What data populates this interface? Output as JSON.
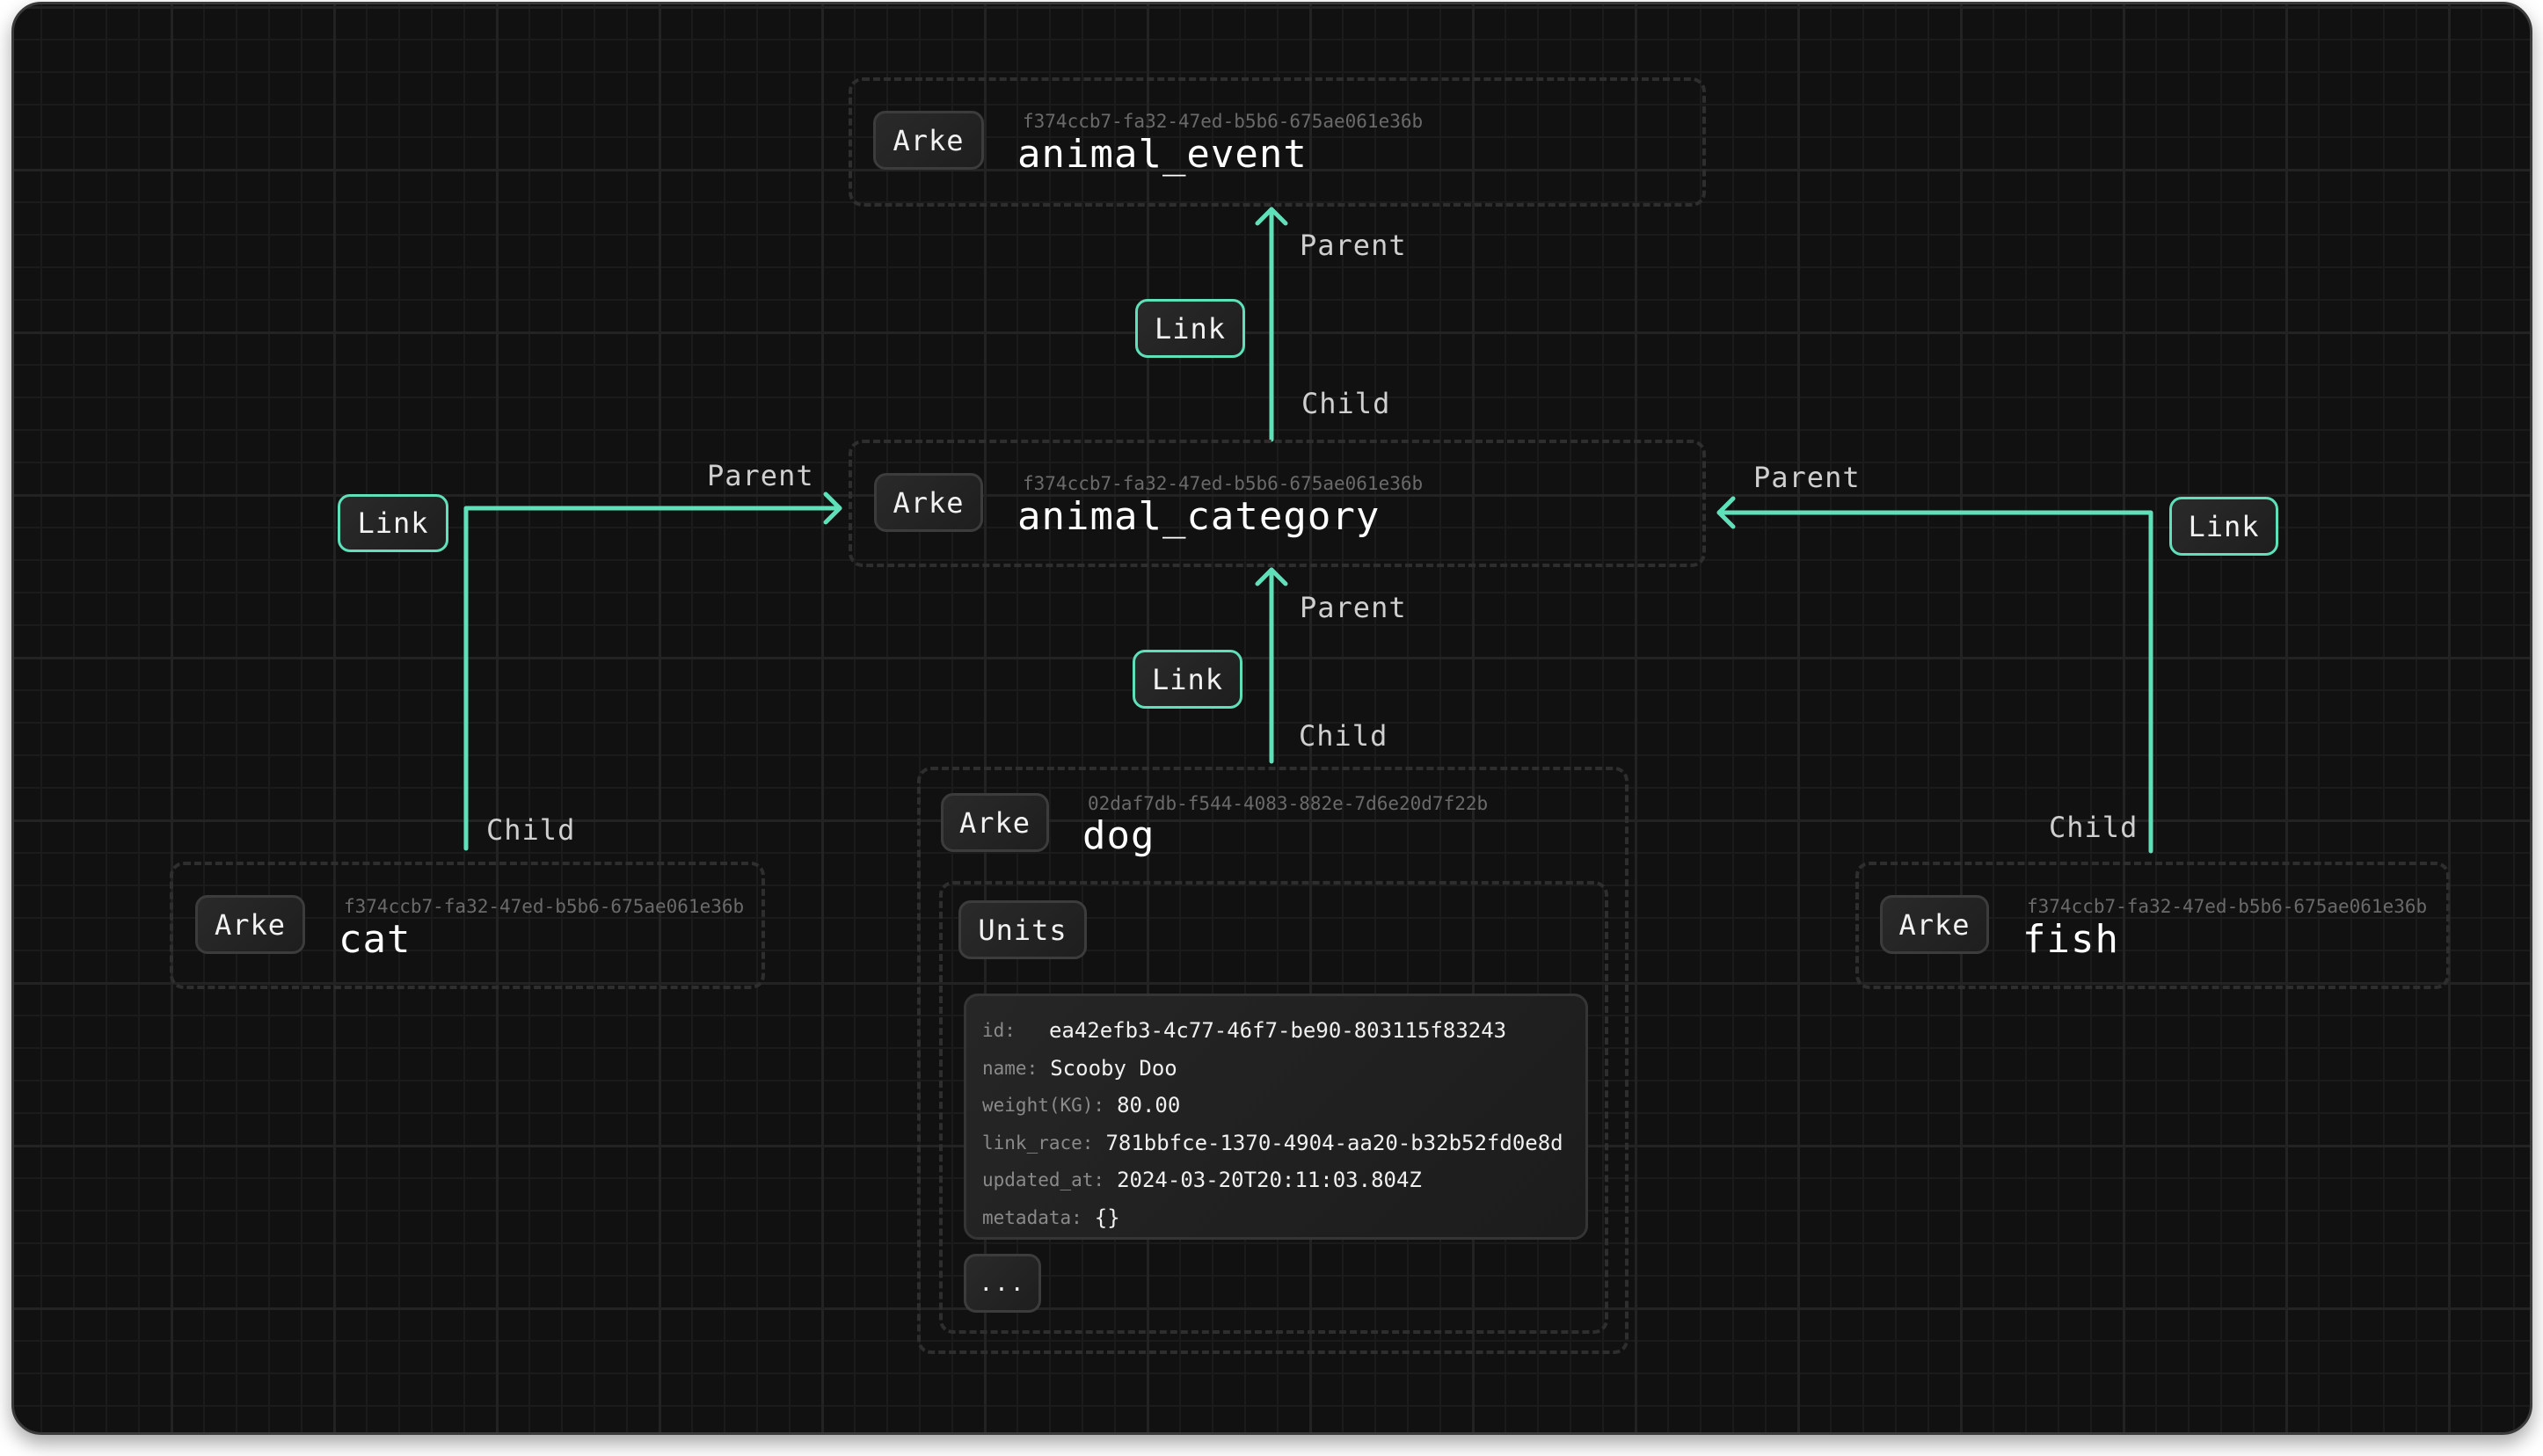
{
  "theme": {
    "accent": "#5fe0b8",
    "background": "#111111",
    "border": "#2e2e2e"
  },
  "nodes": {
    "animal_event": {
      "type_label": "Arke",
      "uuid": "f374ccb7-fa32-47ed-b5b6-675ae061e36b",
      "name": "animal_event"
    },
    "animal_category": {
      "type_label": "Arke",
      "uuid": "f374ccb7-fa32-47ed-b5b6-675ae061e36b",
      "name": "animal_category"
    },
    "dog": {
      "type_label": "Arke",
      "uuid": "02daf7db-f544-4083-882e-7d6e20d7f22b",
      "name": "dog",
      "group_label": "Units",
      "unit": {
        "fields": [
          {
            "key": "id:",
            "value": "ea42efb3-4c77-46f7-be90-803115f83243"
          },
          {
            "key": "name:",
            "value": "Scooby Doo"
          },
          {
            "key": "weight(KG):",
            "value": "80.00"
          },
          {
            "key": "link_race:",
            "value": "781bbfce-1370-4904-aa20-b32b52fd0e8d"
          },
          {
            "key": "updated_at:",
            "value": "2024-03-20T20:11:03.804Z"
          },
          {
            "key": "metadata:",
            "value": "{}"
          }
        ]
      },
      "more_label": "..."
    },
    "cat": {
      "type_label": "Arke",
      "uuid": "f374ccb7-fa32-47ed-b5b6-675ae061e36b",
      "name": "cat"
    },
    "fish": {
      "type_label": "Arke",
      "uuid": "f374ccb7-fa32-47ed-b5b6-675ae061e36b",
      "name": "fish"
    }
  },
  "edges": [
    {
      "from": "animal_category",
      "to": "animal_event",
      "link_label": "Link",
      "parent_label": "Parent",
      "child_label": "Child"
    },
    {
      "from": "dog",
      "to": "animal_category",
      "link_label": "Link",
      "parent_label": "Parent",
      "child_label": "Child"
    },
    {
      "from": "cat",
      "to": "animal_category",
      "link_label": "Link",
      "parent_label": "Parent",
      "child_label": "Child"
    },
    {
      "from": "fish",
      "to": "animal_category",
      "link_label": "Link",
      "parent_label": "Parent",
      "child_label": "Child"
    }
  ]
}
